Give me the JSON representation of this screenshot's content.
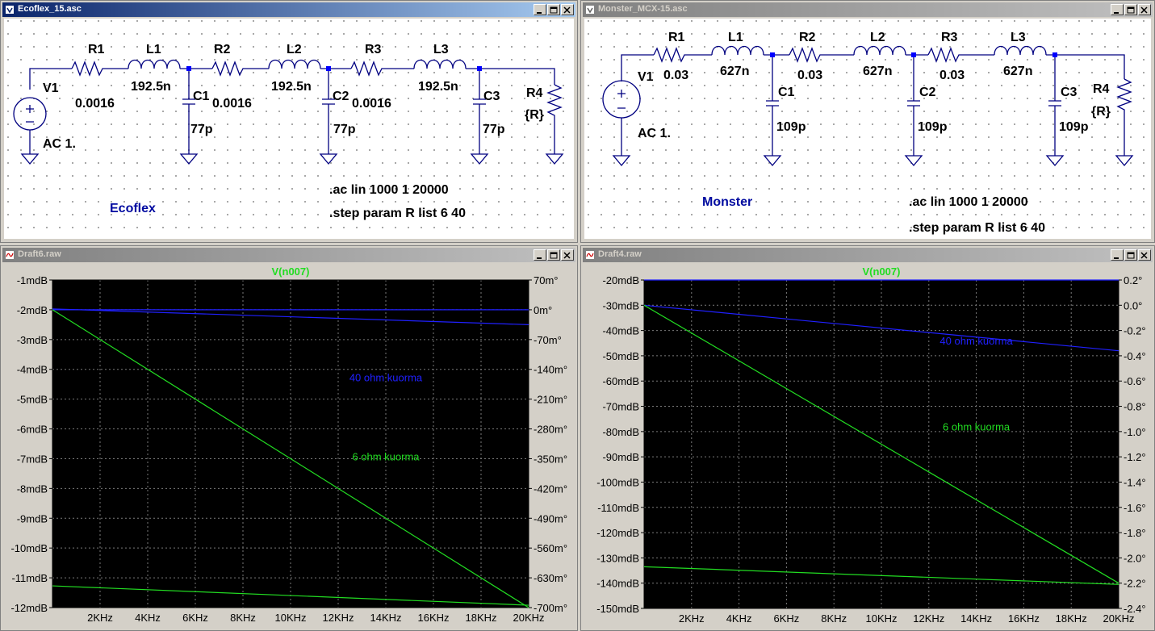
{
  "windows": {
    "sch1": {
      "title": "Ecoflex_15.asc",
      "labels": {
        "R1": "R1",
        "R1v": "0.0016",
        "L1": "L1",
        "L1v": "192.5n",
        "R2": "R2",
        "R2v": "0.0016",
        "L2": "L2",
        "L2v": "192.5n",
        "R3": "R3",
        "R3v": "0.0016",
        "L3": "L3",
        "L3v": "192.5n",
        "V1": "V1",
        "AC": "AC 1.",
        "C1": "C1",
        "C1v": "77p",
        "C2": "C2",
        "C2v": "77p",
        "C3": "C3",
        "C3v": "77p",
        "R4": "R4",
        "R4v": "{R}"
      },
      "name": "Ecoflex",
      "directive1": ".ac lin 1000 1 20000",
      "directive2": ".step param R list 6 40"
    },
    "sch2": {
      "title": "Monster_MCX-15.asc",
      "labels": {
        "R1": "R1",
        "R1v": "0.03",
        "L1": "L1",
        "L1v": "627n",
        "R2": "R2",
        "R2v": "0.03",
        "L2": "L2",
        "L2v": "627n",
        "R3": "R3",
        "R3v": "0.03",
        "L3": "L3",
        "L3v": "627n",
        "V1": "V1",
        "AC": "AC 1.",
        "C1": "C1",
        "C1v": "109p",
        "C2": "C2",
        "C2v": "109p",
        "C3": "C3",
        "C3v": "109p",
        "R4": "R4",
        "R4v": "{R}"
      },
      "name": "Monster",
      "directive1": ".ac lin 1000 1 20000",
      "directive2": ".step param R list 6 40"
    },
    "plot1": {
      "title": "Draft6.raw"
    },
    "plot2": {
      "title": "Draft4.raw"
    }
  },
  "colors": {
    "trace_40ohm": "#2020ff",
    "trace_6ohm": "#22dd22",
    "trace_title": "#22dd22",
    "plot_bg": "#000000",
    "annotation_blue": "#000aa0"
  },
  "chart_data": [
    {
      "type": "line",
      "title": "V(n007)",
      "xlabel": "",
      "x_ticks": [
        "2KHz",
        "4KHz",
        "6KHz",
        "8KHz",
        "10KHz",
        "12KHz",
        "14KHz",
        "16KHz",
        "18KHz",
        "20KHz"
      ],
      "xlim": [
        1,
        20000
      ],
      "y_ticks": [
        "-1mdB",
        "-2mdB",
        "-3mdB",
        "-4mdB",
        "-5mdB",
        "-6mdB",
        "-7mdB",
        "-8mdB",
        "-9mdB",
        "-10mdB",
        "-11mdB",
        "-12mdB"
      ],
      "ylim": [
        -12,
        -1
      ],
      "y2_ticks": [
        "70m°",
        "0m°",
        "-70m°",
        "-140m°",
        "-210m°",
        "-280m°",
        "-350m°",
        "-420m°",
        "-490m°",
        "-560m°",
        "-630m°",
        "-700m°"
      ],
      "y2lim": [
        -700,
        70
      ],
      "grid": true,
      "series": [
        {
          "name": "40 ohm kuorma",
          "color_key": "trace_40ohm",
          "label_x": 14000,
          "label_y": -4.4,
          "x": [
            1,
            20000
          ],
          "y": [
            -1.97,
            -2.5
          ],
          "y2": [
            0,
            0
          ]
        },
        {
          "name": "6 ohm kuorma",
          "color_key": "trace_6ohm",
          "label_x": 14000,
          "label_y": -7.05,
          "x": [
            1,
            20000
          ],
          "y": [
            -11.27,
            -11.92
          ],
          "y2": [
            0,
            -700
          ]
        }
      ]
    },
    {
      "type": "line",
      "title": "V(n007)",
      "xlabel": "",
      "x_ticks": [
        "2KHz",
        "4KHz",
        "6KHz",
        "8KHz",
        "10KHz",
        "12KHz",
        "14KHz",
        "16KHz",
        "18KHz",
        "20KHz"
      ],
      "xlim": [
        1,
        20000
      ],
      "y_ticks": [
        "-20mdB",
        "-30mdB",
        "-40mdB",
        "-50mdB",
        "-60mdB",
        "-70mdB",
        "-80mdB",
        "-90mdB",
        "-100mdB",
        "-110mdB",
        "-120mdB",
        "-130mdB",
        "-140mdB",
        "-150mdB"
      ],
      "ylim": [
        -150,
        -20
      ],
      "y2_ticks": [
        "0.2°",
        "0.0°",
        "-0.2°",
        "-0.4°",
        "-0.6°",
        "-0.8°",
        "-1.0°",
        "-1.2°",
        "-1.4°",
        "-1.6°",
        "-1.8°",
        "-2.0°",
        "-2.2°",
        "-2.4°"
      ],
      "y2lim": [
        -2.4,
        0.2
      ],
      "grid": true,
      "series": [
        {
          "name": "40 ohm kuorma",
          "color_key": "trace_40ohm",
          "label_x": 14000,
          "label_y": -45.5,
          "x": [
            1,
            20000
          ],
          "y": [
            -30,
            -48
          ],
          "y2": [
            0.2,
            0.2
          ]
        },
        {
          "name": "6 ohm kuorma",
          "color_key": "trace_6ohm",
          "label_x": 14000,
          "label_y": -79.5,
          "x": [
            1,
            20000
          ],
          "y": [
            -133.5,
            -140.5
          ],
          "y2": [
            0,
            -2.2
          ]
        }
      ]
    }
  ]
}
